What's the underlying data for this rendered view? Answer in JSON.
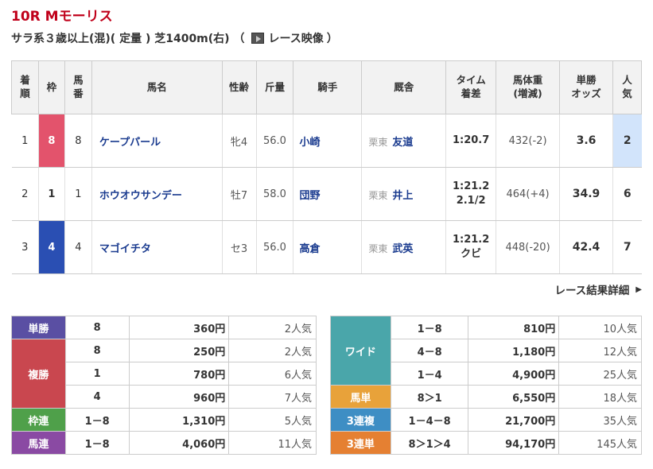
{
  "race": {
    "title": "10R Mモーリス",
    "conditions": "サラ系３歳以上(混)( 定量 ) 芝1400m(右) （",
    "video_label": "レース映像",
    "video_close": "）"
  },
  "table": {
    "headers": [
      "着順",
      "枠",
      "馬番",
      "馬名",
      "性齢",
      "斤量",
      "騎手",
      "厩舎",
      "タイム着差",
      "馬体重(増減)",
      "単勝オッズ",
      "人気"
    ],
    "header_lines": [
      [
        "着",
        "順"
      ],
      [
        "枠"
      ],
      [
        "馬",
        "番"
      ],
      [
        "馬名"
      ],
      [
        "性齢"
      ],
      [
        "斤量"
      ],
      [
        "騎手"
      ],
      [
        "厩舎"
      ],
      [
        "タイム",
        "着差"
      ],
      [
        "馬体重",
        "(増減)"
      ],
      [
        "単勝",
        "オッズ"
      ],
      [
        "人",
        "気"
      ]
    ],
    "rows": [
      {
        "rank": "1",
        "waku": "8",
        "umaban": "8",
        "horse": "ケープパール",
        "sexage": "牝4",
        "weight": "56.0",
        "jockey": "小崎",
        "area": "栗東",
        "trainer": "友道",
        "time": "1:20.7",
        "margin": "",
        "body": "432(-2)",
        "odds": "3.6",
        "pop": "2"
      },
      {
        "rank": "2",
        "waku": "1",
        "umaban": "1",
        "horse": "ホウオウサンデー",
        "sexage": "牡7",
        "weight": "58.0",
        "jockey": "団野",
        "area": "栗東",
        "trainer": "井上",
        "time": "1:21.2",
        "margin": "2.1/2",
        "body": "464(+4)",
        "odds": "34.9",
        "pop": "6"
      },
      {
        "rank": "3",
        "waku": "4",
        "umaban": "4",
        "horse": "マゴイチタ",
        "sexage": "セ3",
        "weight": "56.0",
        "jockey": "高倉",
        "area": "栗東",
        "trainer": "武英",
        "time": "1:21.2",
        "margin": "クビ",
        "body": "448(-20)",
        "odds": "42.4",
        "pop": "7"
      }
    ]
  },
  "detail_link": "レース結果詳細",
  "payout_left": {
    "tansho": {
      "label": "単勝",
      "rows": [
        {
          "combo": "8",
          "yen": "360円",
          "ninki": "2人気"
        }
      ]
    },
    "fukusho": {
      "label": "複勝",
      "rows": [
        {
          "combo": "8",
          "yen": "250円",
          "ninki": "2人気"
        },
        {
          "combo": "1",
          "yen": "780円",
          "ninki": "6人気"
        },
        {
          "combo": "4",
          "yen": "960円",
          "ninki": "7人気"
        }
      ]
    },
    "wakuren": {
      "label": "枠連",
      "rows": [
        {
          "combo": "1－8",
          "yen": "1,310円",
          "ninki": "5人気"
        }
      ]
    },
    "umaren": {
      "label": "馬連",
      "rows": [
        {
          "combo": "1－8",
          "yen": "4,060円",
          "ninki": "11人気"
        }
      ]
    }
  },
  "payout_right": {
    "wide": {
      "label": "ワイド",
      "rows": [
        {
          "combo": "1－8",
          "yen": "810円",
          "ninki": "10人気"
        },
        {
          "combo": "4－8",
          "yen": "1,180円",
          "ninki": "12人気"
        },
        {
          "combo": "1－4",
          "yen": "4,900円",
          "ninki": "25人気"
        }
      ]
    },
    "umatan": {
      "label": "馬単",
      "rows": [
        {
          "combo": "8＞1",
          "yen": "6,550円",
          "ninki": "18人気"
        }
      ]
    },
    "sanrenpuku": {
      "label": "3連複",
      "rows": [
        {
          "combo": "1－4－8",
          "yen": "21,700円",
          "ninki": "35人気"
        }
      ]
    },
    "sanrentan": {
      "label": "3連単",
      "rows": [
        {
          "combo": "8＞1＞4",
          "yen": "94,170円",
          "ninki": "145人気"
        }
      ]
    }
  },
  "colors": {
    "title": "#c0001a",
    "waku_8": "#e3536c",
    "waku_4": "#2a4fb3",
    "favorite_highlight": "#d2e4fb"
  }
}
